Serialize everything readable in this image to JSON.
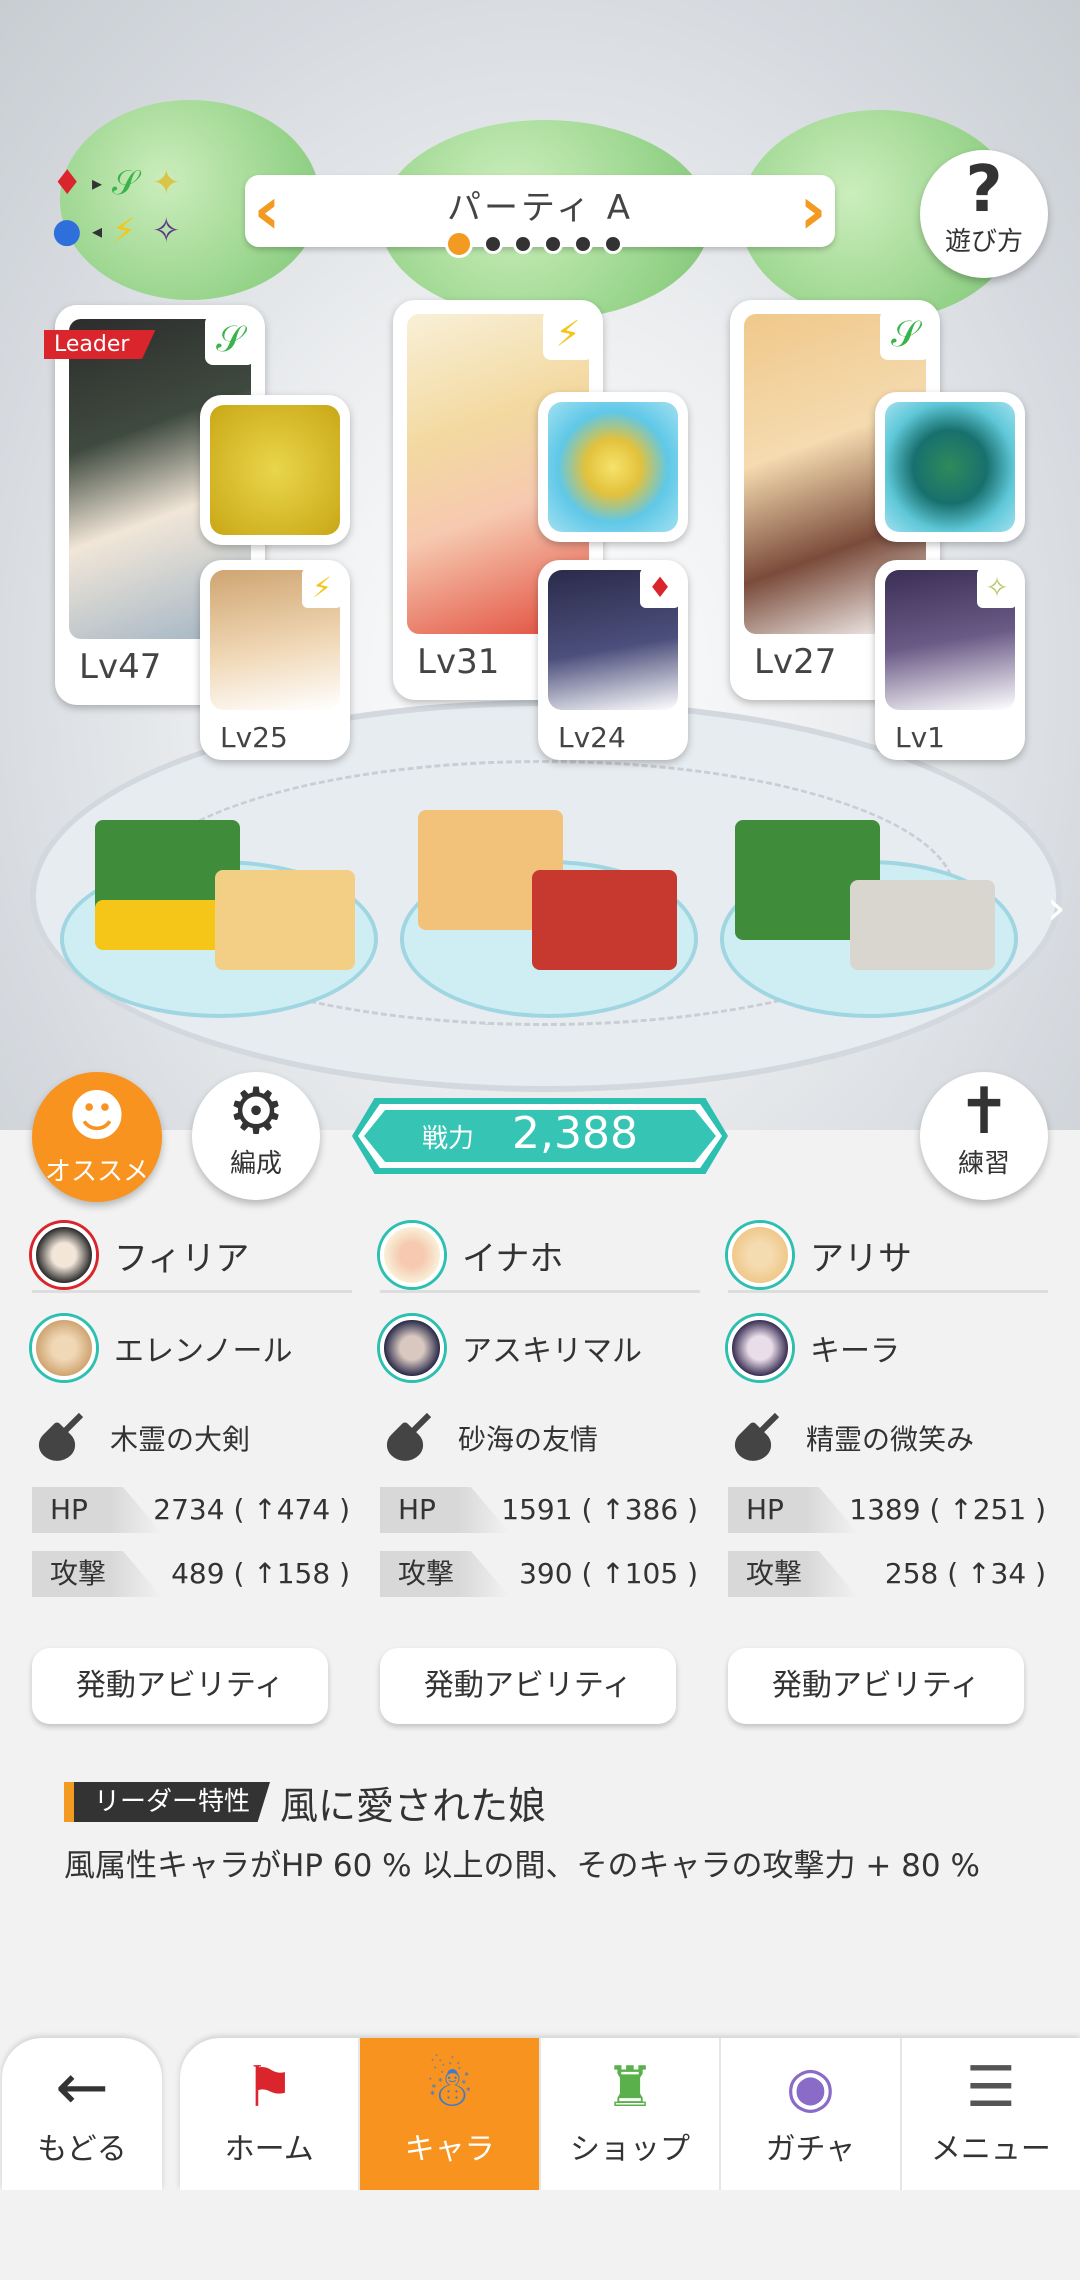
{
  "header": {
    "party_title": "パーティ A",
    "help_label": "遊び方",
    "element_icons": [
      "♦",
      "▸",
      "𝒮",
      "✦",
      "●",
      "◂",
      "⚡",
      "✧"
    ]
  },
  "party_dots": {
    "count": 6,
    "active_index": 0
  },
  "members": [
    {
      "leader_tag": "Leader",
      "main_level": "Lv47",
      "element_icon": "𝒮",
      "sub_level": "Lv25",
      "sub_element_icon": "⚡"
    },
    {
      "main_level": "Lv31",
      "element_icon": "⚡",
      "sub_level": "Lv24",
      "sub_element_icon": "♦"
    },
    {
      "main_level": "Lv27",
      "element_icon": "𝒮",
      "sub_level": "Lv1",
      "sub_element_icon": "✧"
    }
  ],
  "buttons": {
    "recommend": "オススメ",
    "formation": "編成",
    "practice": "練習"
  },
  "power": {
    "label": "戦力",
    "value": "2,388"
  },
  "stats": [
    {
      "main": "フィリア",
      "sub": "エレンノール",
      "weapon": "木霊の大剣",
      "hp_label": "HP",
      "hp": "2734 ( ↑474 )",
      "atk_label": "攻撃",
      "atk": "489 ( ↑158 )",
      "ability": "発動アビリティ"
    },
    {
      "main": "イナホ",
      "sub": "アスキリマル",
      "weapon": "砂海の友情",
      "hp_label": "HP",
      "hp": "1591 ( ↑386 )",
      "atk_label": "攻撃",
      "atk": "390 ( ↑105 )",
      "ability": "発動アビリティ"
    },
    {
      "main": "アリサ",
      "sub": "キーラ",
      "weapon": "精霊の微笑み",
      "hp_label": "HP",
      "hp": "1389 ( ↑251 )",
      "atk_label": "攻撃",
      "atk": "258 ( ↑34 )",
      "ability": "発動アビリティ"
    }
  ],
  "leader_trait": {
    "tag": "リーダー特性",
    "name": "風に愛された娘",
    "description": "風属性キャラがHP 60 % 以上の間、そのキャラの攻撃力 + 80 %"
  },
  "nav": {
    "back": "もどる",
    "items": [
      "ホーム",
      "キャラ",
      "ショップ",
      "ガチャ",
      "メニュー"
    ],
    "active": "キャラ"
  },
  "colors": {
    "accent": "#f7931e",
    "teal": "#2dbfb0",
    "leader_red": "#d9252b"
  }
}
